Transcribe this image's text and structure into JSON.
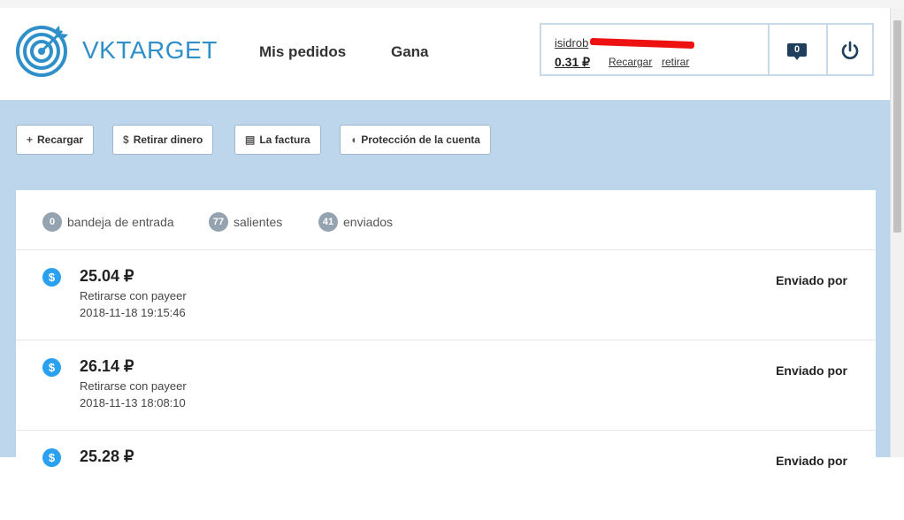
{
  "brand": {
    "name": "VKTARGET",
    "color": "#2e8fc9"
  },
  "nav": [
    {
      "label": "Mis pedidos"
    },
    {
      "label": "Gana"
    }
  ],
  "account": {
    "email_visible": "isidrob",
    "balance": "0.31 ₽",
    "recharge_label": "Recargar",
    "withdraw_label": "retirar",
    "messages_count": "0"
  },
  "actions": [
    {
      "label": "Recargar",
      "icon": "plus-icon",
      "glyph": "+"
    },
    {
      "label": "Retirar dinero",
      "icon": "dollar-icon",
      "glyph": "$"
    },
    {
      "label": "La factura",
      "icon": "document-icon",
      "glyph": "▤"
    },
    {
      "label": "Protección de la cuenta",
      "icon": "shield-icon",
      "glyph": "◖"
    }
  ],
  "filters": [
    {
      "count": "0",
      "label": "bandeja de entrada"
    },
    {
      "count": "77",
      "label": "salientes"
    },
    {
      "count": "41",
      "label": "enviados"
    }
  ],
  "transactions": [
    {
      "amount": "25.04 ₽",
      "description": "Retirarse con payeer",
      "date": "2018-11-18 19:15:46",
      "status": "Enviado por"
    },
    {
      "amount": "26.14 ₽",
      "description": "Retirarse con payeer",
      "date": "2018-11-13 18:08:10",
      "status": "Enviado por"
    },
    {
      "amount": "25.28 ₽",
      "description": "",
      "date": "",
      "status": "Enviado por"
    }
  ],
  "colors": {
    "accent": "#2aa1f0",
    "panel_bg": "#bed6eb",
    "badge_dark": "#1f3f5c",
    "redaction": "#ee1111"
  }
}
